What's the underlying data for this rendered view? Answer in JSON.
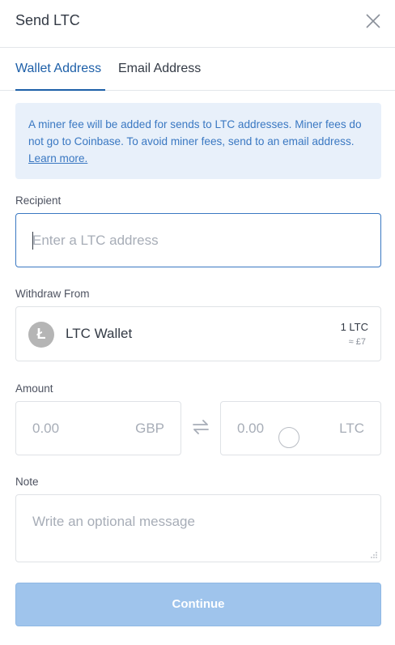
{
  "header": {
    "title": "Send LTC",
    "close_icon": "close-icon"
  },
  "tabs": [
    {
      "label": "Wallet Address",
      "active": true
    },
    {
      "label": "Email Address",
      "active": false
    }
  ],
  "notice": {
    "text": "A miner fee will be added for sends to LTC addresses. Miner fees do not go to Coinbase. To avoid miner fees, send to an email address.",
    "link": "Learn more."
  },
  "recipient": {
    "label": "Recipient",
    "placeholder": "Enter a LTC address"
  },
  "withdraw": {
    "label": "Withdraw From",
    "wallet_name": "LTC Wallet",
    "coin_glyph": "Ł",
    "balance": "1 LTC",
    "approx": "≈ £7"
  },
  "amount": {
    "label": "Amount",
    "fiat_value": "0.00",
    "fiat_currency": "GBP",
    "crypto_value": "0.00",
    "crypto_currency": "LTC",
    "swap_icon": "swap-icon"
  },
  "note": {
    "label": "Note",
    "placeholder": "Write an optional message"
  },
  "continue_label": "Continue",
  "colors": {
    "accent": "#1d5fa8",
    "notice_bg": "#e8f0fa",
    "button_disabled": "#9fc4ec"
  }
}
